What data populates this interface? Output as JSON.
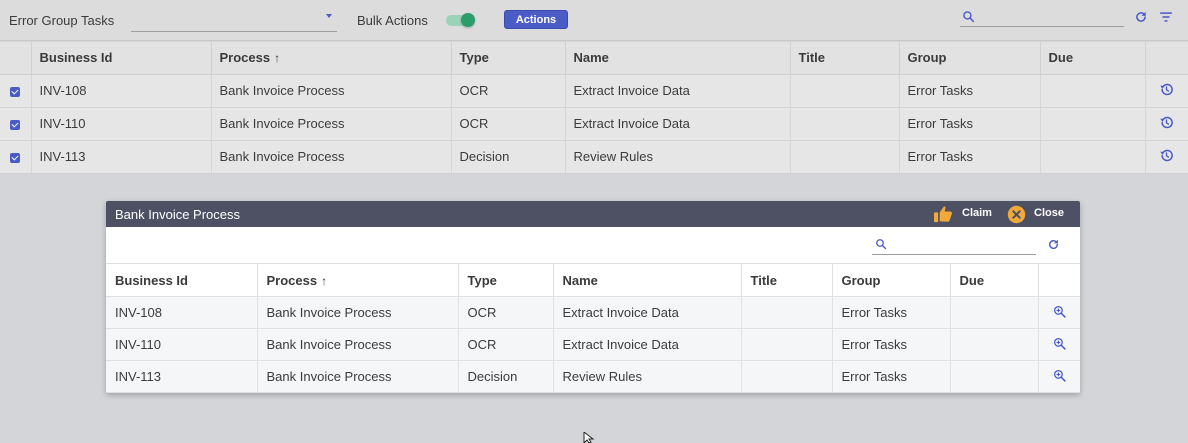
{
  "toolbar": {
    "filter_label": "Error Group Tasks",
    "dropdown_value": "",
    "bulk_actions_label": "Bulk Actions",
    "bulk_actions_enabled": true,
    "actions_button": "Actions",
    "search_placeholder": "",
    "search_icon": "search-icon",
    "refresh_icon": "refresh-icon",
    "filter_icon": "filter-list-icon"
  },
  "colors": {
    "accent": "#4c5cc6",
    "toggle_on": "#2a9d6a",
    "dialog_header": "#4d5163",
    "claim_icon": "#f0a93a",
    "close_icon": "#f0a93a"
  },
  "main_table": {
    "columns": [
      "",
      "Business Id",
      "Process",
      "Type",
      "Name",
      "Title",
      "Group",
      "Due",
      ""
    ],
    "sort_column": "Process",
    "sort_direction": "ascending",
    "rows": [
      {
        "selected": true,
        "business_id": "INV-108",
        "process": "Bank Invoice Process",
        "type": "OCR",
        "name": "Extract Invoice Data",
        "title": "",
        "group": "Error Tasks",
        "due": "",
        "action_icon": "history-icon"
      },
      {
        "selected": true,
        "business_id": "INV-110",
        "process": "Bank Invoice Process",
        "type": "OCR",
        "name": "Extract Invoice Data",
        "title": "",
        "group": "Error Tasks",
        "due": "",
        "action_icon": "history-icon"
      },
      {
        "selected": true,
        "business_id": "INV-113",
        "process": "Bank Invoice Process",
        "type": "Decision",
        "name": "Review Rules",
        "title": "",
        "group": "Error Tasks",
        "due": "",
        "action_icon": "history-icon"
      }
    ]
  },
  "dialog": {
    "title": "Bank Invoice Process",
    "claim_label": "Claim",
    "close_label": "Close",
    "search_placeholder": "",
    "columns": [
      "Business Id",
      "Process",
      "Type",
      "Name",
      "Title",
      "Group",
      "Due",
      ""
    ],
    "sort_column": "Process",
    "rows": [
      {
        "business_id": "INV-108",
        "process": "Bank Invoice Process",
        "type": "OCR",
        "name": "Extract Invoice Data",
        "title": "",
        "group": "Error Tasks",
        "due": "",
        "action_icon": "zoom-in-icon"
      },
      {
        "business_id": "INV-110",
        "process": "Bank Invoice Process",
        "type": "OCR",
        "name": "Extract Invoice Data",
        "title": "",
        "group": "Error Tasks",
        "due": "",
        "action_icon": "zoom-in-icon"
      },
      {
        "business_id": "INV-113",
        "process": "Bank Invoice Process",
        "type": "Decision",
        "name": "Review Rules",
        "title": "",
        "group": "Error Tasks",
        "due": "",
        "action_icon": "zoom-in-icon"
      }
    ]
  }
}
